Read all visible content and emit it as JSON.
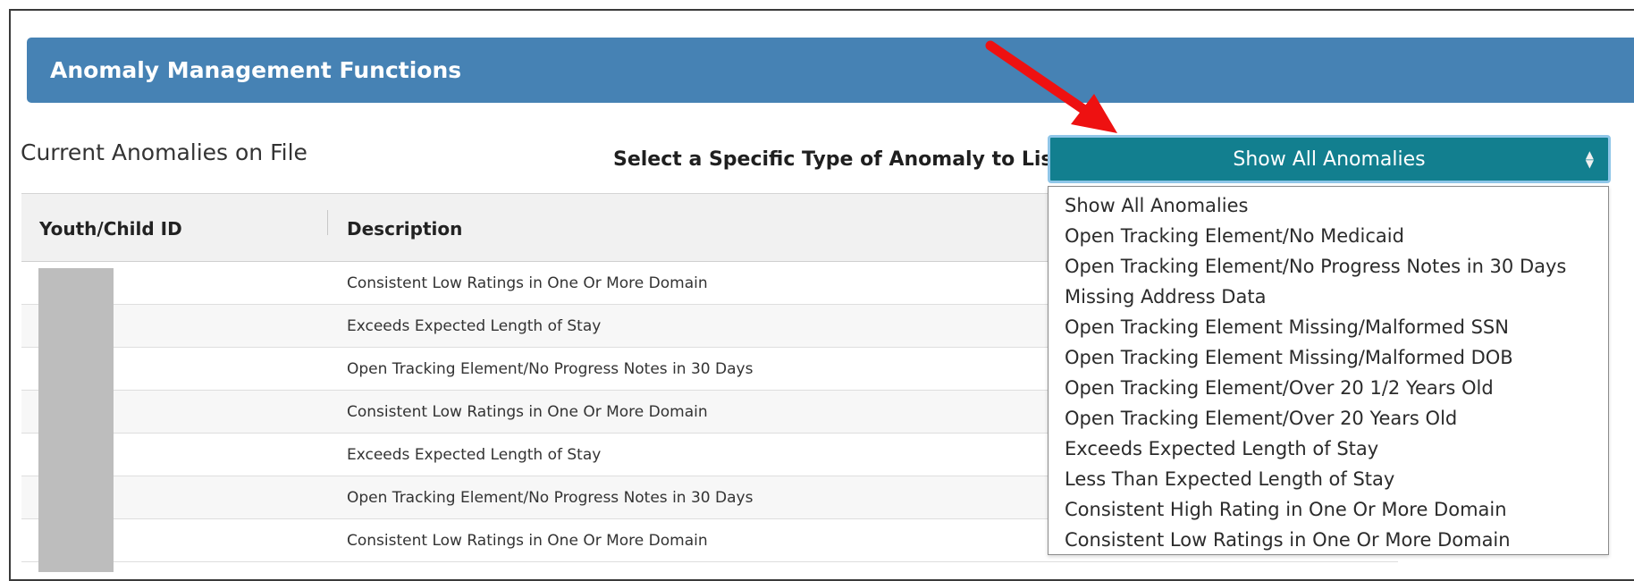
{
  "banner": {
    "title": "Anomaly Management Functions"
  },
  "section": {
    "title": "Current Anomalies on File"
  },
  "filter": {
    "label": "Select a Specific Type of Anomaly to List",
    "selected": "Show All Anomalies",
    "caret_icon": "updown-caret-icon",
    "options": [
      "Show All Anomalies",
      "Open Tracking Element/No Medicaid",
      "Open Tracking Element/No Progress Notes in 30 Days",
      "Missing Address Data",
      "Open Tracking Element Missing/Malformed SSN",
      "Open Tracking Element Missing/Malformed DOB",
      "Open Tracking Element/Over 20 1/2 Years Old",
      "Open Tracking Element/Over 20 Years Old",
      "Exceeds Expected Length of Stay",
      "Less Than Expected Length of Stay",
      "Consistent High Rating in One Or More Domain",
      "Consistent Low Ratings in One Or More Domain"
    ]
  },
  "table": {
    "columns": [
      "Youth/Child ID",
      "Description"
    ],
    "rows": [
      {
        "id": "",
        "description": "Consistent Low Ratings in One Or More Domain"
      },
      {
        "id": "",
        "description": "Exceeds Expected Length of Stay"
      },
      {
        "id": "",
        "description": "Open Tracking Element/No Progress Notes in 30 Days"
      },
      {
        "id": "",
        "description": "Consistent Low Ratings in One Or More Domain"
      },
      {
        "id": "",
        "description": "Exceeds Expected Length of Stay"
      },
      {
        "id": "",
        "description": "Open Tracking Element/No Progress Notes in 30 Days"
      },
      {
        "id": "",
        "description": "Consistent Low Ratings in One Or More Domain"
      }
    ]
  },
  "colors": {
    "banner": "#4682b4",
    "select": "#127f8f",
    "select_border": "#8fc6e8",
    "annotation_arrow": "#ee1111"
  }
}
